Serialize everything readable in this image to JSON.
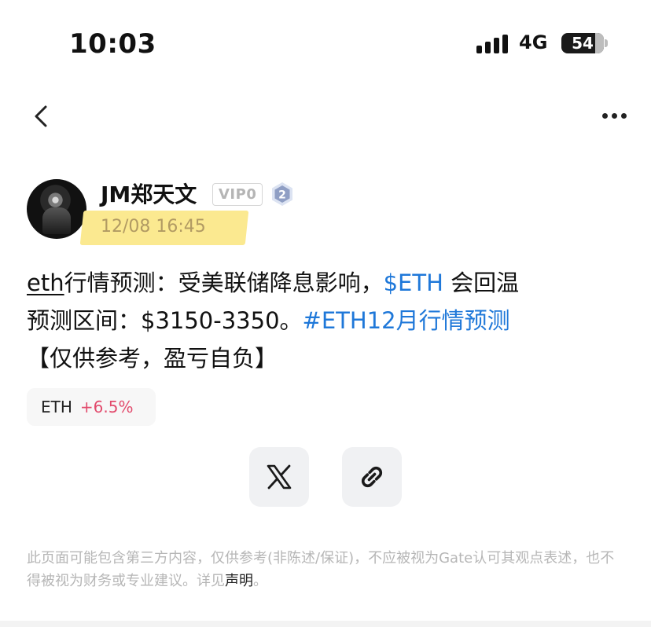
{
  "status_bar": {
    "time": "10:03",
    "network": "4G",
    "battery": "54"
  },
  "nav": {
    "back_icon": "chevron-left-icon",
    "more_icon": "ellipsis-icon"
  },
  "post": {
    "author": "JM郑天文",
    "vip_badge": "VIP0",
    "level": "2",
    "timestamp": "12/08 16:45",
    "content": {
      "line1_prefix": "eth",
      "line1_text": "行情预测：受美联储降息影响，",
      "line1_link": "$ETH",
      "line1_suffix": " 会回温",
      "line2_text": "预测区间：$3150-3350。",
      "line2_link": "#ETH12月行情预测",
      "line3_text": "【仅供参考，盈亏自负】"
    },
    "tag": {
      "symbol": "ETH",
      "change": "+6.5%"
    }
  },
  "share": {
    "x_icon": "x-logo-icon",
    "link_icon": "link-icon"
  },
  "disclaimer": {
    "text": "此页面可能包含第三方内容，仅供参考(非陈述/保证)，不应被视为Gate认可其观点表述，也不得被视为财务或专业建议。详见",
    "link": "声明",
    "end": "。"
  },
  "colors": {
    "link": "#1f78d9",
    "positive_change": "#e24a6c",
    "highlight": "#fbe990",
    "timestamp": "#b19a63"
  }
}
